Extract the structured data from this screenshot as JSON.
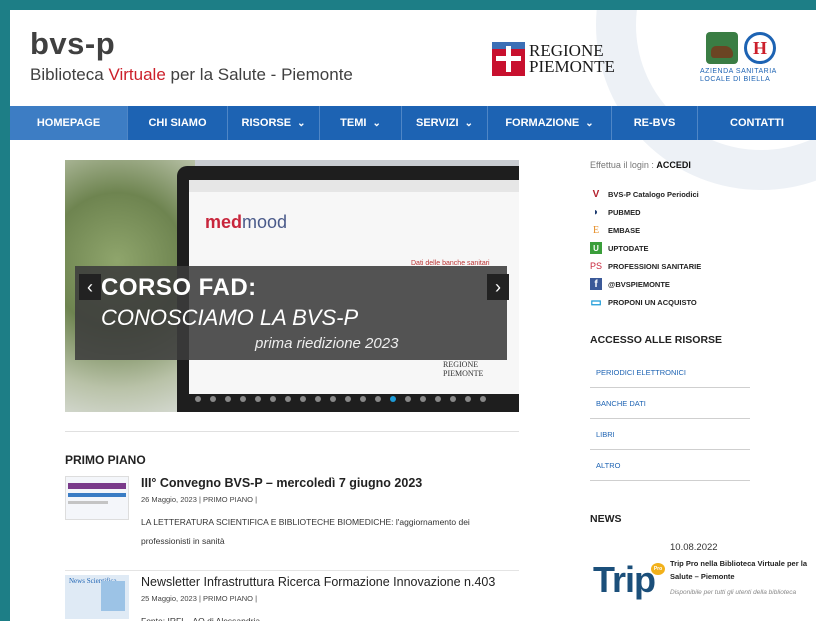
{
  "header": {
    "logo_title": "bvs-p",
    "logo_sub_pre": "Biblioteca ",
    "logo_sub_red": "Virtuale",
    "logo_sub_post": " per la Salute - Piemonte",
    "regione_line1": "REGIONE",
    "regione_line2": "PIEMONTE",
    "asl_caption": "AZIENDA SANITARIA LOCALE DI BIELLA",
    "asl_emblem_letter": "H"
  },
  "nav": {
    "items": [
      {
        "label": "HOMEPAGE",
        "dropdown": ""
      },
      {
        "label": "CHI SIAMO",
        "dropdown": ""
      },
      {
        "label": "RISORSE",
        "dropdown": "⌄"
      },
      {
        "label": "TEMI",
        "dropdown": "⌄"
      },
      {
        "label": "SERVIZI",
        "dropdown": "⌄"
      },
      {
        "label": "FORMAZIONE",
        "dropdown": "⌄"
      },
      {
        "label": "RE-BVS",
        "dropdown": ""
      },
      {
        "label": "CONTATTI",
        "dropdown": ""
      }
    ]
  },
  "slider": {
    "title": "CORSO FAD:",
    "subtitle": "CONOSCIAMO LA BVS-P",
    "edition": "prima riedizione 2023",
    "brand_a": "med",
    "brand_b": "mood",
    "small_caption": "Dati delle banche sanitari",
    "small_regione": "REGIONE PIEMONTE",
    "prev": "‹",
    "next": "›"
  },
  "primo_piano": {
    "heading": "PRIMO PIANO",
    "posts": [
      {
        "title": "III° Convegno BVS-P – mercoledì 7 giugno 2023",
        "meta": "26 Maggio, 2023 | PRIMO PIANO |",
        "excerpt": "LA LETTERATURA SCIENTIFICA E BIBLIOTECHE BIOMEDICHE: l'aggiornamento dei professionisti in sanità"
      },
      {
        "title": "Newsletter Infrastruttura Ricerca Formazione Innovazione n.403",
        "meta": "25 Maggio, 2023 | PRIMO PIANO |",
        "excerpt": "Fonte: IRFI – AO di Alessandria",
        "thumb_text": "News Scientifica"
      }
    ]
  },
  "sidebar": {
    "login_pre": "Effettua il login : ",
    "login_link": "ACCEDI",
    "links": [
      {
        "icon": "V",
        "label": "BVS-P Catalogo Periodici",
        "color": "#b3202c"
      },
      {
        "icon": "◗",
        "label": "PUBMED",
        "color": "#1d3b70"
      },
      {
        "icon": "E",
        "label": "EMBASE",
        "color": "#e58a1f"
      },
      {
        "icon": "U",
        "label": "UPTODATE",
        "color": "#3a9e3a"
      },
      {
        "icon": "PS",
        "label": "PROFESSIONI SANITARIE",
        "color": "#c8263c"
      },
      {
        "icon": "f",
        "label": "@BVSPIEMONTE",
        "color": "#3b5998"
      },
      {
        "icon": "▭",
        "label": "PROPONI UN ACQUISTO",
        "color": "#1d9bd7"
      }
    ],
    "risorse_heading": "ACCESSO ALLE RISORSE",
    "risorse": [
      "PERIODICI ELETTRONICI",
      "BANCHE DATI",
      "LIBRI",
      "ALTRO"
    ],
    "news_heading": "NEWS",
    "news": {
      "date": "10.08.2022",
      "title": "Trip Pro nella Biblioteca Virtuale per la Salute – Piemonte",
      "subtitle": "Disponibile per tutti gli utenti della biblioteca",
      "logo": "Trip",
      "logo_badge": "Pro"
    }
  }
}
